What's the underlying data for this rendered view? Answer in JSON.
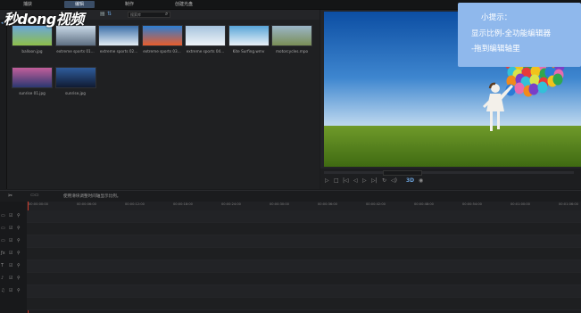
{
  "topbar": {
    "tabs": [
      {
        "label": "捕获",
        "active": false
      },
      {
        "label": "编辑",
        "active": true
      },
      {
        "label": "制作",
        "active": false
      },
      {
        "label": "创建光盘",
        "active": false
      }
    ]
  },
  "watermark": "秒dong视频",
  "library": {
    "search_placeholder": "搜索库",
    "media": [
      {
        "label": "balloon.jpg",
        "colors": [
          "#6aa6da",
          "#8fbf4a"
        ]
      },
      {
        "label": "extreme sports 01...",
        "colors": [
          "#c9d9e8",
          "#5e6f82"
        ]
      },
      {
        "label": "extreme sports 02...",
        "colors": [
          "#3a6ea8",
          "#e3ecf4"
        ]
      },
      {
        "label": "extreme sports 03...",
        "colors": [
          "#2d7ed1",
          "#e85d2c"
        ]
      },
      {
        "label": "extreme sports 04...",
        "colors": [
          "#a5c3dd",
          "#eff4f8"
        ]
      },
      {
        "label": "Kite Surfing.wmv",
        "colors": [
          "#58a5d8",
          "#e9f1f7"
        ]
      },
      {
        "label": "motorcycles.mpo",
        "colors": [
          "#9bb6c9",
          "#7a8e56"
        ]
      },
      {
        "label": "sunrise 01.jpg",
        "colors": [
          "#c25f9b",
          "#2b3770"
        ]
      },
      {
        "label": "sunrise.jpg",
        "colors": [
          "#2f5c9c",
          "#101b33"
        ]
      }
    ]
  },
  "preview": {
    "sky_colors": [
      "#0c4ea3",
      "#3e86cf",
      "#cfe3f3"
    ],
    "grass_colors": [
      "#6f9a2a",
      "#3f6a12"
    ]
  },
  "tip": {
    "title": "小提示：",
    "line1": "显示比例-全功能编辑器",
    "line2": "-拖到编辑轴里"
  },
  "timeline": {
    "toolbar_hint": "使用滑块调整时间轴显示比例。",
    "ruler_ticks": [
      "00:00:00:00",
      "00:00:06:00",
      "00:00:12:00",
      "00:00:18:00",
      "00:00:24:00",
      "00:00:30:00",
      "00:00:36:00",
      "00:00:42:00",
      "00:00:48:00",
      "00:00:54:00",
      "00:01:00:00",
      "00:01:06:00"
    ],
    "clip_color": "#5b98cc",
    "playhead_color": "#d13a2a"
  },
  "colors": {
    "active_tab": "#3a4d66",
    "tip_bg": "#8fb8ec"
  }
}
